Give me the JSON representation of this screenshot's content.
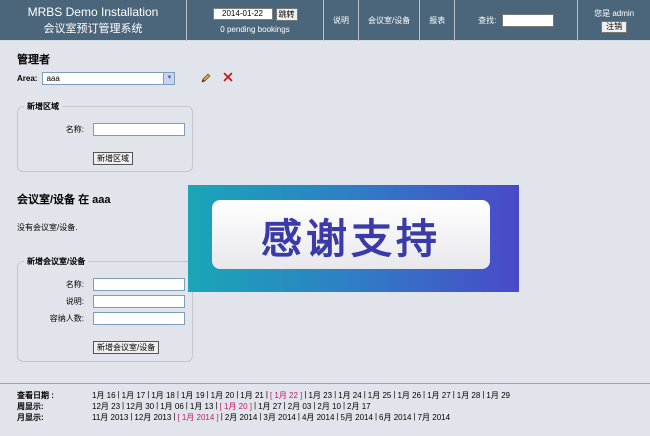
{
  "banner": {
    "title": "MRBS Demo Installation",
    "subtitle": "会议室预订管理系统",
    "date_value": "2014-01-22",
    "go_label": "跳转",
    "pending": "0 pending bookings",
    "nav_help": "说明",
    "nav_rooms": "会议室/设备",
    "nav_report": "报表",
    "search_label": "查找:",
    "user_label": "您是 admin",
    "logout_label": "注销"
  },
  "admin": {
    "title": "管理者",
    "area_label": "Area:",
    "area_selected": "aaa"
  },
  "new_area": {
    "legend": "新增区域",
    "name_label": "名称:",
    "button": "新增区域"
  },
  "rooms": {
    "title": "会议室/设备 在 aaa",
    "empty_msg": "没有会议室/设备."
  },
  "new_room": {
    "legend": "新增会议室/设备",
    "name_label": "名称:",
    "desc_label": "说明:",
    "capacity_label": "容纳人数:",
    "button": "新增会议室/设备"
  },
  "overlay": {
    "text": "感谢支持"
  },
  "footer": {
    "day_label": "查看日期 :",
    "days": [
      "1月 16",
      "1月 17",
      "1月 18",
      "1月 19",
      "1月 20",
      "1月 21",
      "[ 1月 22 ]",
      "1月 23",
      "1月 24",
      "1月 25",
      "1月 26",
      "1月 27",
      "1月 28",
      "1月 29"
    ],
    "day_current": 6,
    "week_label": "周显示:",
    "weeks": [
      "12月 23",
      "12月 30",
      "1月 06",
      "1月 13",
      "[ 1月 20 ]",
      "1月 27",
      "2月 03",
      "2月 10",
      "2月 17"
    ],
    "week_current": 4,
    "month_label": "月显示:",
    "months": [
      "11月 2013",
      "12月 2013",
      "[ 1月 2014 ]",
      "2月 2014",
      "3月 2014",
      "4月 2014",
      "5月 2014",
      "6月 2014",
      "7月 2014"
    ],
    "month_current": 2
  },
  "colors": {
    "banner": "#4b667b",
    "current_link": "#c11b6e",
    "background": "#e1e5eb"
  }
}
